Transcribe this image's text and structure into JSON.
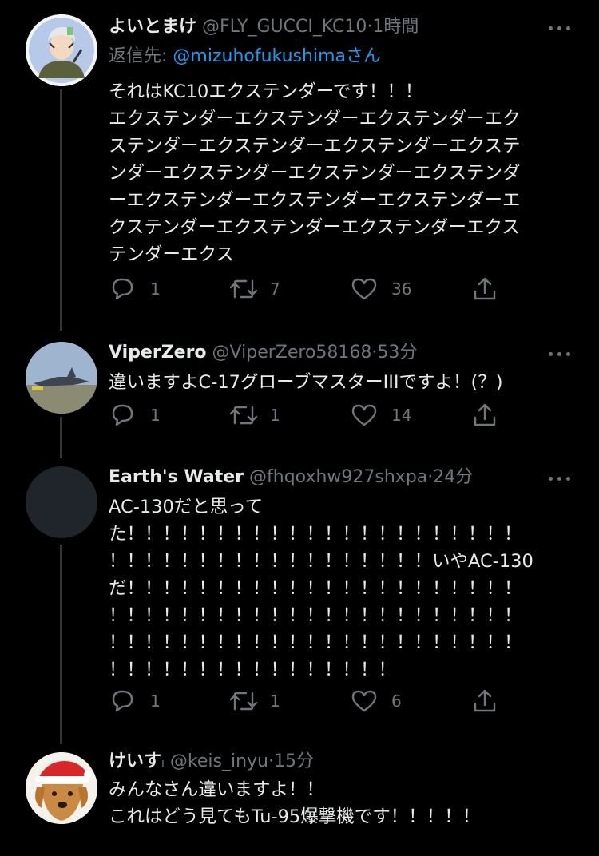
{
  "colors": {
    "background": "#000000",
    "text": "#e7e9ea",
    "muted": "#71767b",
    "link": "#1d9bf0",
    "line": "#333639"
  },
  "tweets": [
    {
      "name": "よいとまけ",
      "handle": "@FLY_GUCCI_KC10",
      "time": "1時間",
      "reply_label": "返信先:",
      "reply_to": "@mizuhofukushima",
      "reply_suffix": "さん",
      "lines": [
        "それはKC10エクステンダーです！！！",
        "エクステンダーエクステンダーエクステンダーエク",
        "ステンダーエクステンダーエクステンダーエクステ",
        "ンダーエクステンダーエクステンダーエクステンダ",
        "ーエクステンダーエクステンダーエクステンダーエ",
        "クステンダーエクステンダーエクステンダーエクス",
        "テンダーエクス"
      ],
      "replies": "1",
      "retweets": "7",
      "likes": "36"
    },
    {
      "name": "ViperZero",
      "handle": "@ViperZero58168",
      "time": "53分",
      "lines": [
        "違いますよC-17グローブマスターIIIですよ！(？)"
      ],
      "replies": "1",
      "retweets": "1",
      "likes": "14"
    },
    {
      "name": "Earth's Water",
      "handle": "@fhqoxhw927shxpa",
      "time": "24分",
      "lines": [
        "AC-130だと思って",
        "た！！！！！！！！！！！！！！！！！！！！！！",
        "！！！！！！！！！！！！！！！！！！いやAC-130",
        "だ！！！！！！！！！！！！！！！！！！！！！！",
        "！！！！！！！！！！！！！！！！！！！！！！！",
        "！！！！！！！！！！！！！！！！！！！！！！！",
        "！！！！！！！！！！！！！！！！"
      ],
      "replies": "1",
      "retweets": "1",
      "likes": "6"
    },
    {
      "name": "けいす",
      "name_suffix": "ı",
      "handle": "@keis_inyu",
      "time": "15分",
      "lines": [
        "みんなさん違いますよ！！",
        "これはどう見てもTu-95爆撃機です！！！！！"
      ]
    }
  ]
}
